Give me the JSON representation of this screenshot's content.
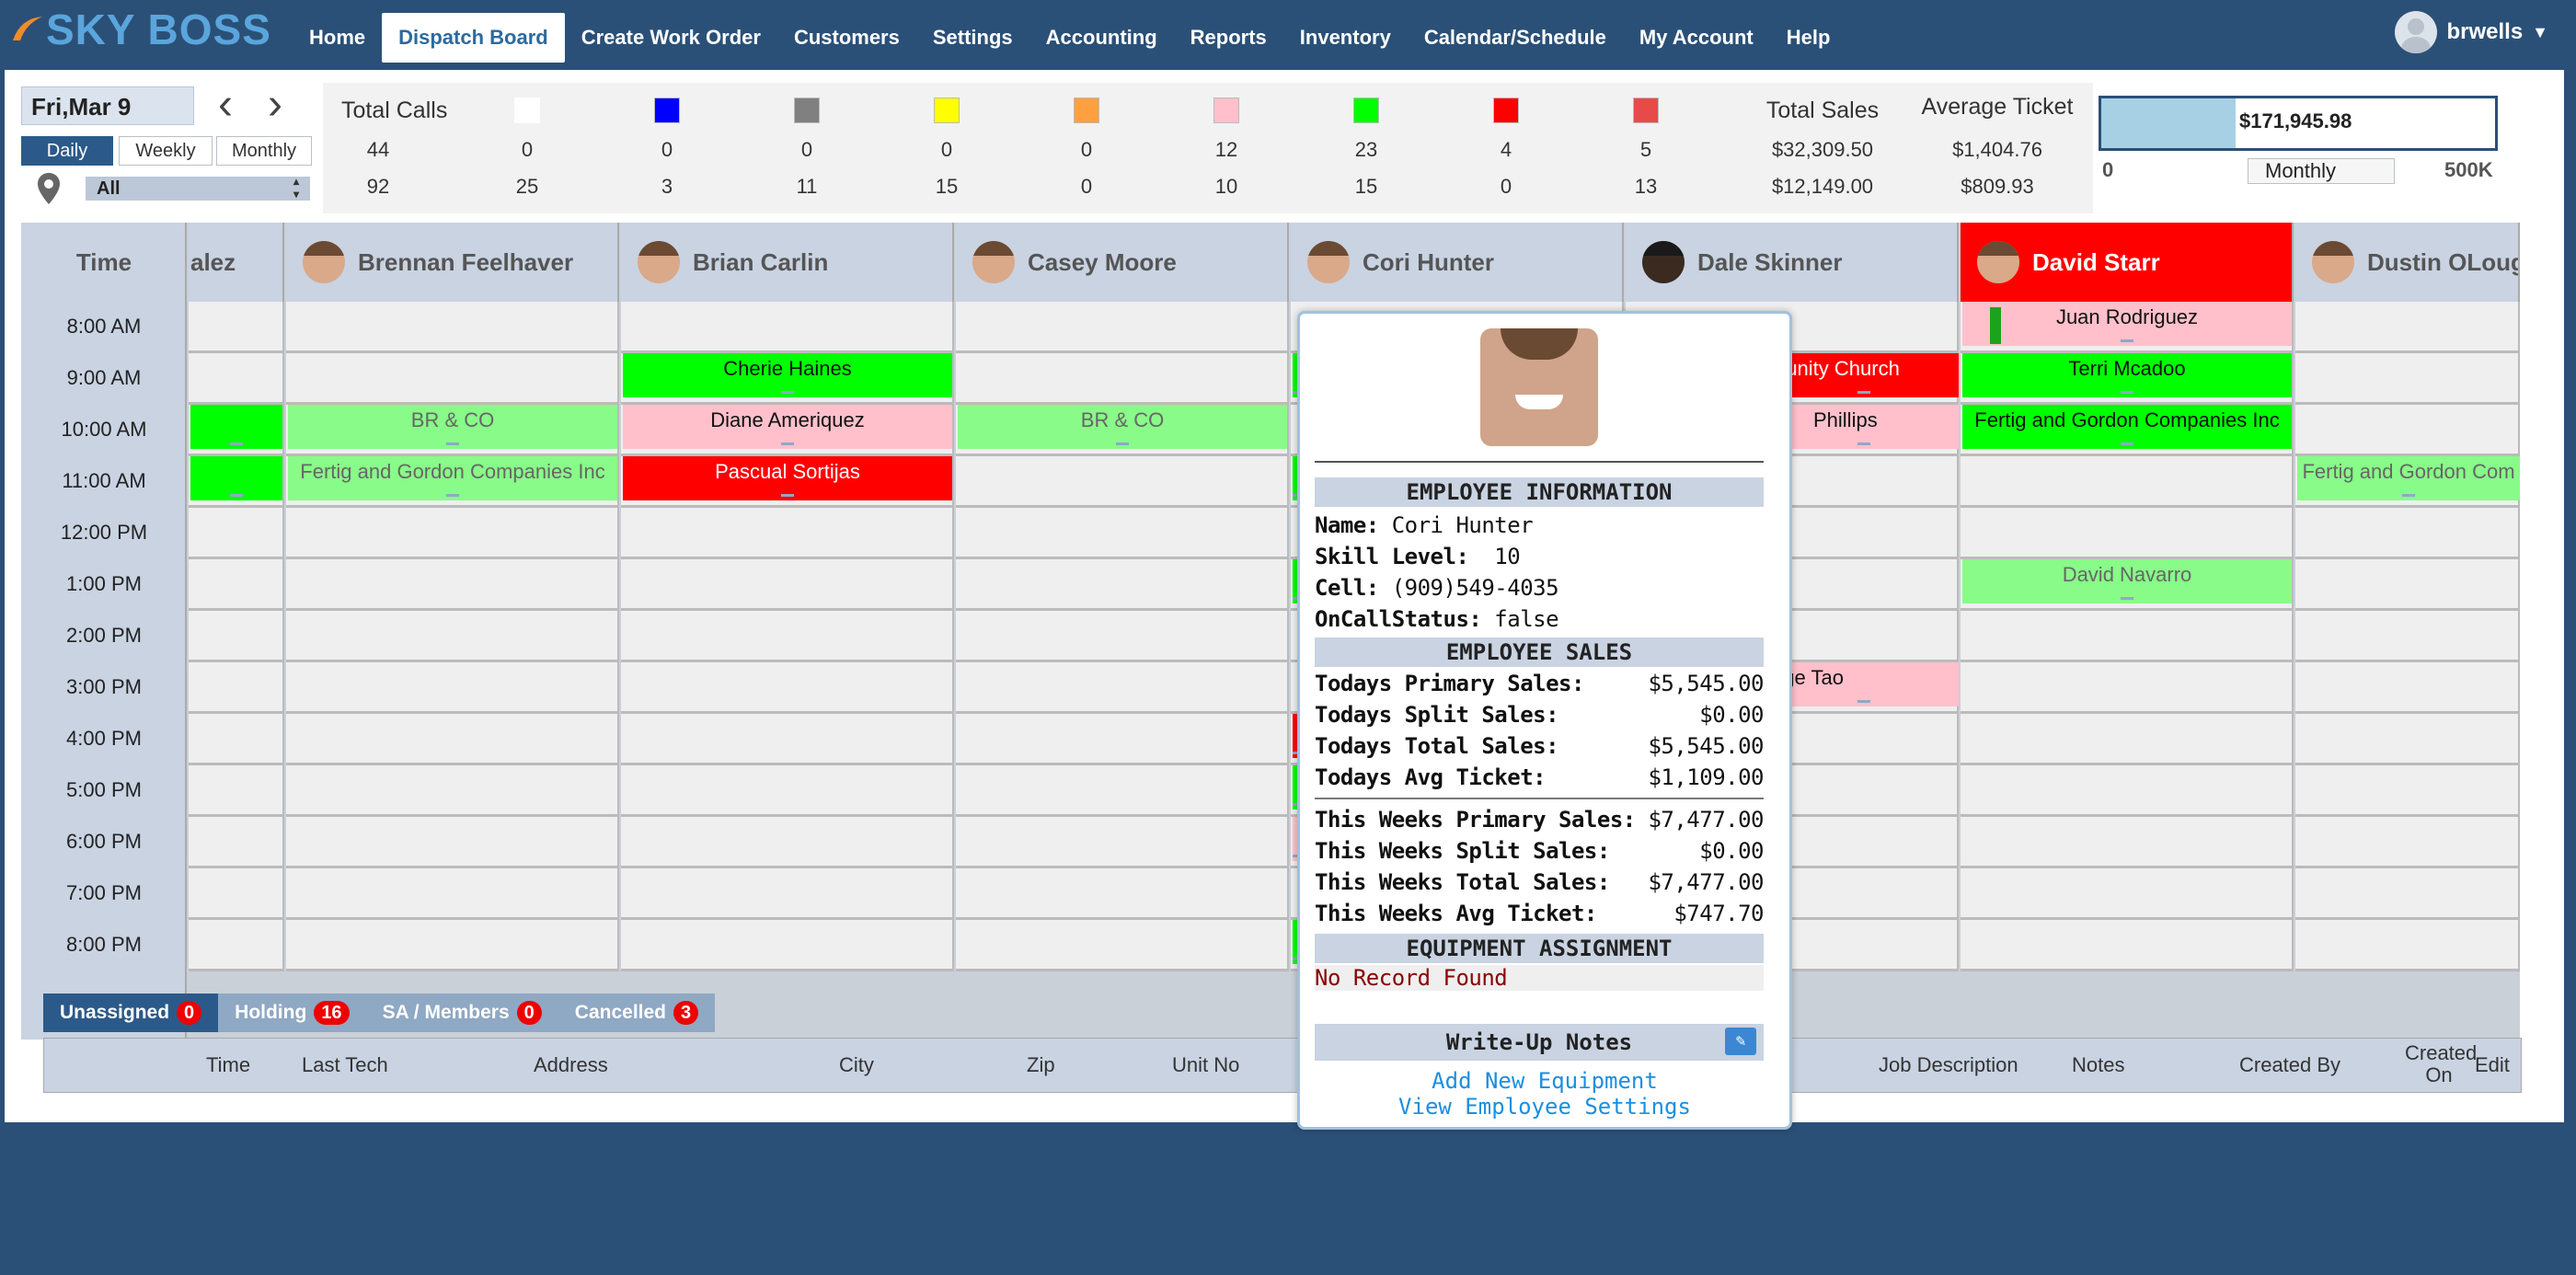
{
  "nav": {
    "logo": "SKY BOSS",
    "items": [
      "Home",
      "Dispatch Board",
      "Create Work Order",
      "Customers",
      "Settings",
      "Accounting",
      "Reports",
      "Inventory",
      "Calendar/Schedule",
      "My Account",
      "Help"
    ],
    "active": "Dispatch Board",
    "user": "brwells"
  },
  "controls": {
    "date": "Fri,Mar 9",
    "views": [
      "Daily",
      "Weekly",
      "Monthly"
    ],
    "active_view": "Daily",
    "location": "All"
  },
  "stats": {
    "total_calls_label": "Total Calls",
    "total_sales_label": "Total Sales",
    "avg_ticket_label": "Average Ticket",
    "status_colors": [
      "#ffffff",
      "#0000ff",
      "#808080",
      "#ffff00",
      "#ffa040",
      "#ffc0cb",
      "#00ff00",
      "#ff0000",
      "#e84a4a"
    ],
    "row1": {
      "total_calls": "44",
      "counts": [
        "0",
        "0",
        "0",
        "0",
        "0",
        "12",
        "23",
        "4",
        "5"
      ],
      "total_sales": "$32,309.50",
      "avg_ticket": "$1,404.76"
    },
    "row2": {
      "total_calls": "92",
      "counts": [
        "25",
        "3",
        "11",
        "15",
        "0",
        "10",
        "15",
        "0",
        "13"
      ],
      "total_sales": "$12,149.00",
      "avg_ticket": "$809.93"
    }
  },
  "sales_meter": {
    "value": "$171,945.98",
    "fraction": 0.34,
    "min": "0",
    "max": "500K",
    "period": "Monthly"
  },
  "board": {
    "time_header": "Time",
    "times": [
      "8:00 AM",
      "9:00 AM",
      "10:00 AM",
      "11:00 AM",
      "12:00 PM",
      "1:00 PM",
      "2:00 PM",
      "3:00 PM",
      "4:00 PM",
      "5:00 PM",
      "6:00 PM",
      "7:00 PM",
      "8:00 PM"
    ],
    "techs": [
      "alez",
      "Brennan Feelhaver",
      "Brian Carlin",
      "Casey Moore",
      "Cori Hunter",
      "Dale Skinner",
      "David Starr",
      "Dustin OLoug"
    ],
    "jobs": {
      "j1": "Cherie Haines",
      "j2": "BR & CO",
      "j3": "Diane Ameriquez",
      "j4": "BR & CO",
      "j5": "Fertig and Gordon Companies Inc",
      "j6": "Pascual Sortijas",
      "j7": "Juan Rodriguez",
      "j8": "Terri Mcadoo",
      "j9": "Fertig and Gordon Companies Inc",
      "j10": "David Navarro",
      "j11": "Fertig and Gordon Com",
      "j12": "munity Church",
      "j13": "Phillips",
      "j14": "rge Tao"
    }
  },
  "tabs": [
    {
      "label": "Unassigned",
      "count": "0"
    },
    {
      "label": "Holding",
      "count": "16"
    },
    {
      "label": "SA / Members",
      "count": "0"
    },
    {
      "label": "Cancelled",
      "count": "3"
    }
  ],
  "list_columns": [
    "Time",
    "Last Tech",
    "Address",
    "City",
    "Zip",
    "Unit No",
    "Job Description",
    "Notes",
    "Created By",
    "Created On",
    "Edit"
  ],
  "popup": {
    "section_info": "EMPLOYEE INFORMATION",
    "name_label": "Name:",
    "name": "Cori Hunter",
    "skill_label": "Skill Level:",
    "skill": "10",
    "cell_label": "Cell:",
    "cell": "(909)549-4035",
    "oncall_label": "OnCallStatus:",
    "oncall": "false",
    "section_sales": "EMPLOYEE SALES",
    "today_primary_label": "Todays Primary Sales:",
    "today_primary": "$5,545.00",
    "today_split_label": "Todays Split Sales:",
    "today_split": "$0.00",
    "today_total_label": "Todays Total Sales:",
    "today_total": "$5,545.00",
    "today_avg_label": "Todays Avg Ticket:",
    "today_avg": "$1,109.00",
    "week_primary_label": "This Weeks Primary Sales:",
    "week_primary": "$7,477.00",
    "week_split_label": "This Weeks Split Sales:",
    "week_split": "$0.00",
    "week_total_label": "This Weeks Total Sales:",
    "week_total": "$7,477.00",
    "week_avg_label": "This Weeks Avg Ticket:",
    "week_avg": "$747.70",
    "section_equipment": "EQUIPMENT ASSIGNMENT",
    "no_record": "No Record Found",
    "writeup": "Write-Up Notes",
    "add_equipment": "Add New Equipment",
    "view_settings": "View Employee Settings"
  }
}
